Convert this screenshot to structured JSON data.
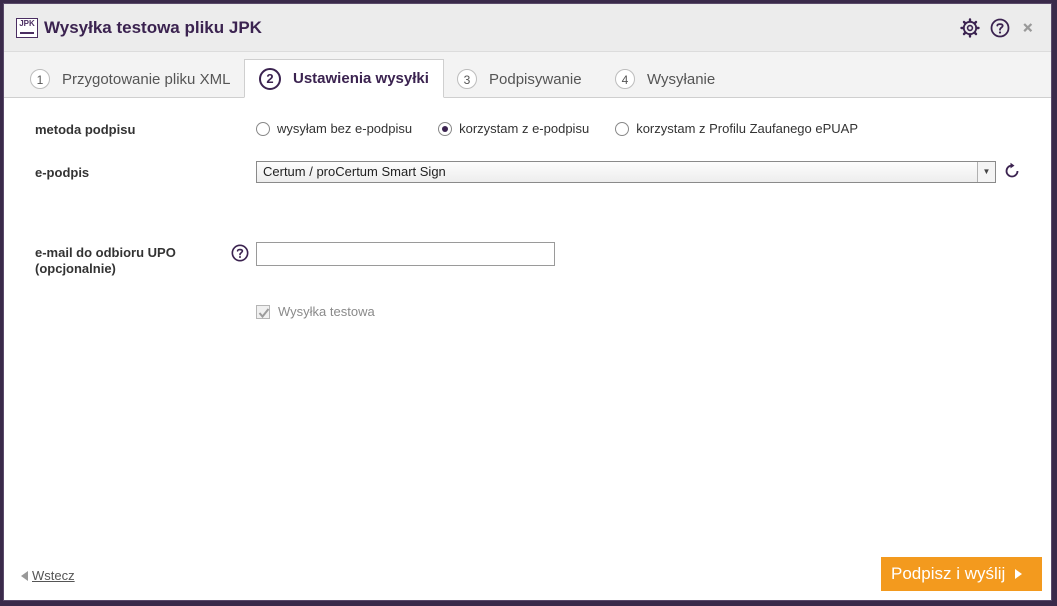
{
  "window": {
    "logo_text": "JPK",
    "title": "Wysyłka testowa pliku JPK"
  },
  "tabs": [
    {
      "num": "1",
      "label": "Przygotowanie pliku XML",
      "active": false
    },
    {
      "num": "2",
      "label": "Ustawienia wysyłki",
      "active": true
    },
    {
      "num": "3",
      "label": "Podpisywanie",
      "active": false
    },
    {
      "num": "4",
      "label": "Wysyłanie",
      "active": false
    }
  ],
  "form": {
    "signature_method": {
      "label": "metoda podpisu",
      "options": [
        {
          "label": "wysyłam bez e-podpisu",
          "checked": false
        },
        {
          "label": "korzystam z e-podpisu",
          "checked": true
        },
        {
          "label": "korzystam z Profilu Zaufanego ePUAP",
          "checked": false
        }
      ]
    },
    "epodpis": {
      "label": "e-podpis",
      "selected": "Certum / proCertum Smart Sign"
    },
    "email": {
      "label_line1": "e-mail do odbioru UPO",
      "label_line2": "(opcjonalnie)",
      "value": "",
      "placeholder": ""
    },
    "test_send": {
      "label": "Wysyłka testowa",
      "checked": true,
      "disabled": true
    }
  },
  "footer": {
    "back_label": "Wstecz",
    "primary_label": "Podpisz i wyślij"
  },
  "colors": {
    "brand": "#3b2350",
    "accent": "#f39a1e"
  }
}
